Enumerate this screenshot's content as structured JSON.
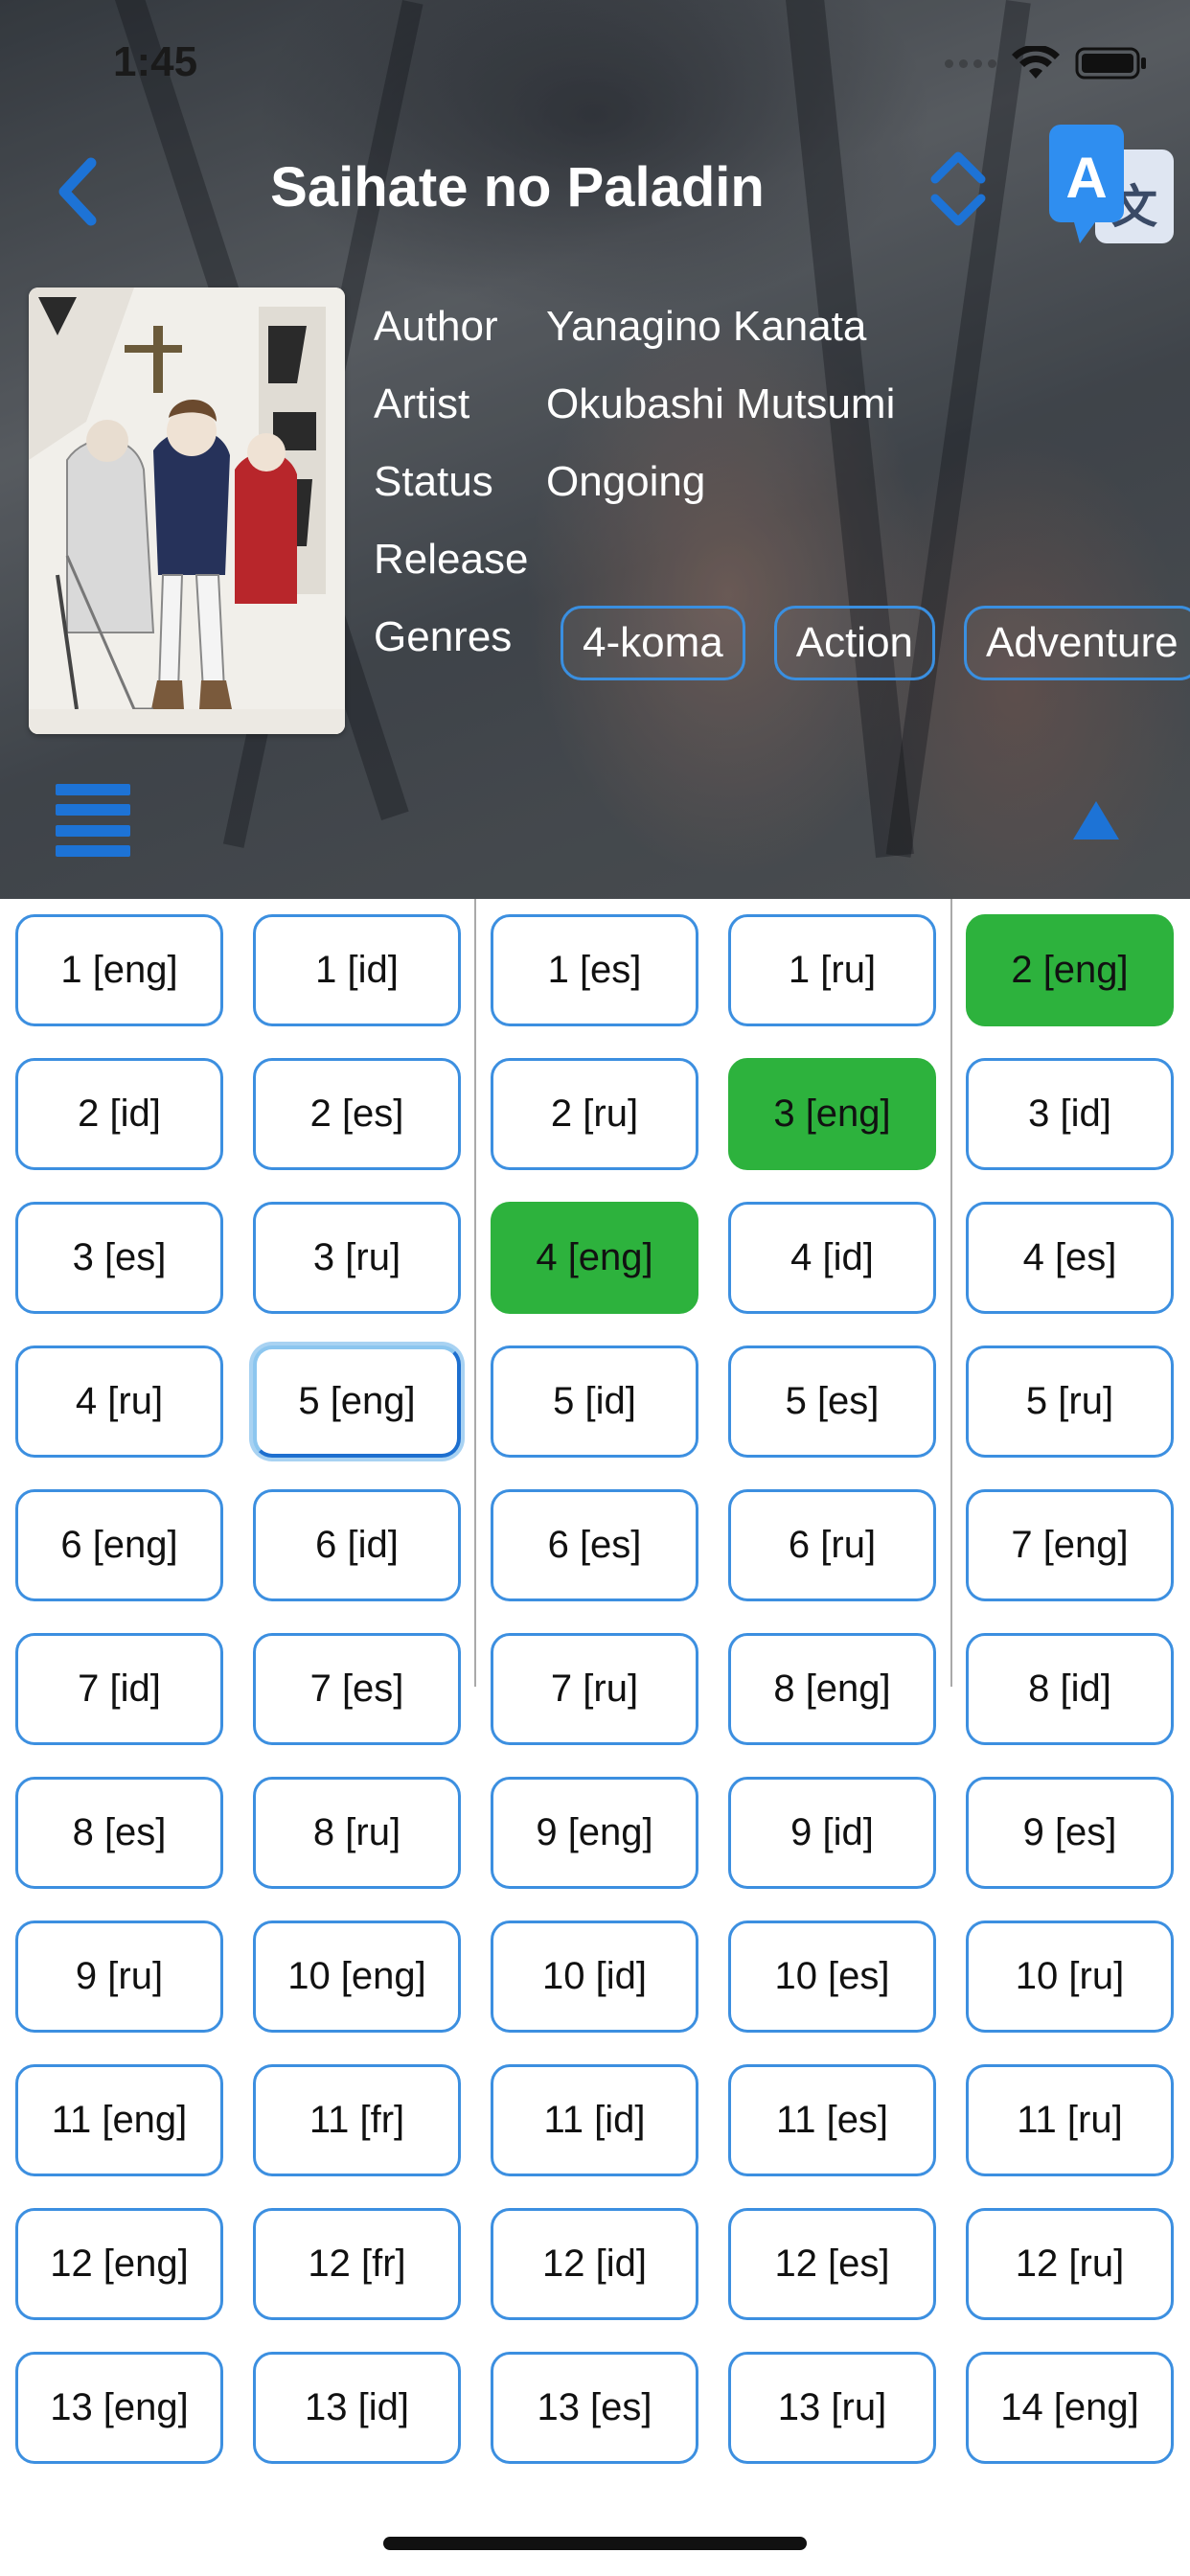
{
  "status_bar": {
    "time": "1:45"
  },
  "header": {
    "title": "Saihate no Paladin",
    "back_icon": "chevron-left-icon",
    "sort_icon": "sort-updown-icon",
    "translate_icon": "translate-icon",
    "menu_icon": "list-menu-icon",
    "collapse_icon": "triangle-up-icon"
  },
  "details": {
    "author_label": "Author",
    "author": "Yanagino Kanata",
    "artist_label": "Artist",
    "artist": "Okubashi Mutsumi",
    "status_label": "Status",
    "status": "Ongoing",
    "release_label": "Release",
    "release": "",
    "genres_label": "Genres",
    "genres": [
      "4-koma",
      "Action",
      "Adventure"
    ]
  },
  "colors": {
    "accent": "#1d73d6",
    "read_chapter": "#2db23d",
    "chip_border": "#3c8fe0"
  },
  "chapters": [
    {
      "label": "1 [eng]",
      "state": "normal"
    },
    {
      "label": "1 [id]",
      "state": "normal"
    },
    {
      "label": "1 [es]",
      "state": "normal"
    },
    {
      "label": "1 [ru]",
      "state": "normal"
    },
    {
      "label": "2 [eng]",
      "state": "read"
    },
    {
      "label": "2 [id]",
      "state": "normal"
    },
    {
      "label": "2 [es]",
      "state": "normal"
    },
    {
      "label": "2 [ru]",
      "state": "normal"
    },
    {
      "label": "3 [eng]",
      "state": "read"
    },
    {
      "label": "3 [id]",
      "state": "normal"
    },
    {
      "label": "3 [es]",
      "state": "normal"
    },
    {
      "label": "3 [ru]",
      "state": "normal"
    },
    {
      "label": "4 [eng]",
      "state": "read"
    },
    {
      "label": "4 [id]",
      "state": "normal"
    },
    {
      "label": "4 [es]",
      "state": "normal"
    },
    {
      "label": "4 [ru]",
      "state": "normal"
    },
    {
      "label": "5 [eng]",
      "state": "current"
    },
    {
      "label": "5 [id]",
      "state": "normal"
    },
    {
      "label": "5 [es]",
      "state": "normal"
    },
    {
      "label": "5 [ru]",
      "state": "normal"
    },
    {
      "label": "6 [eng]",
      "state": "normal"
    },
    {
      "label": "6 [id]",
      "state": "normal"
    },
    {
      "label": "6 [es]",
      "state": "normal"
    },
    {
      "label": "6 [ru]",
      "state": "normal"
    },
    {
      "label": "7 [eng]",
      "state": "normal"
    },
    {
      "label": "7 [id]",
      "state": "normal"
    },
    {
      "label": "7 [es]",
      "state": "normal"
    },
    {
      "label": "7 [ru]",
      "state": "normal"
    },
    {
      "label": "8 [eng]",
      "state": "normal"
    },
    {
      "label": "8 [id]",
      "state": "normal"
    },
    {
      "label": "8 [es]",
      "state": "normal"
    },
    {
      "label": "8 [ru]",
      "state": "normal"
    },
    {
      "label": "9 [eng]",
      "state": "normal"
    },
    {
      "label": "9 [id]",
      "state": "normal"
    },
    {
      "label": "9 [es]",
      "state": "normal"
    },
    {
      "label": "9 [ru]",
      "state": "normal"
    },
    {
      "label": "10 [eng]",
      "state": "normal"
    },
    {
      "label": "10 [id]",
      "state": "normal"
    },
    {
      "label": "10 [es]",
      "state": "normal"
    },
    {
      "label": "10 [ru]",
      "state": "normal"
    },
    {
      "label": "11 [eng]",
      "state": "normal"
    },
    {
      "label": "11 [fr]",
      "state": "normal"
    },
    {
      "label": "11 [id]",
      "state": "normal"
    },
    {
      "label": "11 [es]",
      "state": "normal"
    },
    {
      "label": "11 [ru]",
      "state": "normal"
    },
    {
      "label": "12 [eng]",
      "state": "normal"
    },
    {
      "label": "12 [fr]",
      "state": "normal"
    },
    {
      "label": "12 [id]",
      "state": "normal"
    },
    {
      "label": "12 [es]",
      "state": "normal"
    },
    {
      "label": "12 [ru]",
      "state": "normal"
    },
    {
      "label": "13 [eng]",
      "state": "normal"
    },
    {
      "label": "13 [id]",
      "state": "normal"
    },
    {
      "label": "13 [es]",
      "state": "normal"
    },
    {
      "label": "13 [ru]",
      "state": "normal"
    },
    {
      "label": "14 [eng]",
      "state": "normal"
    }
  ]
}
